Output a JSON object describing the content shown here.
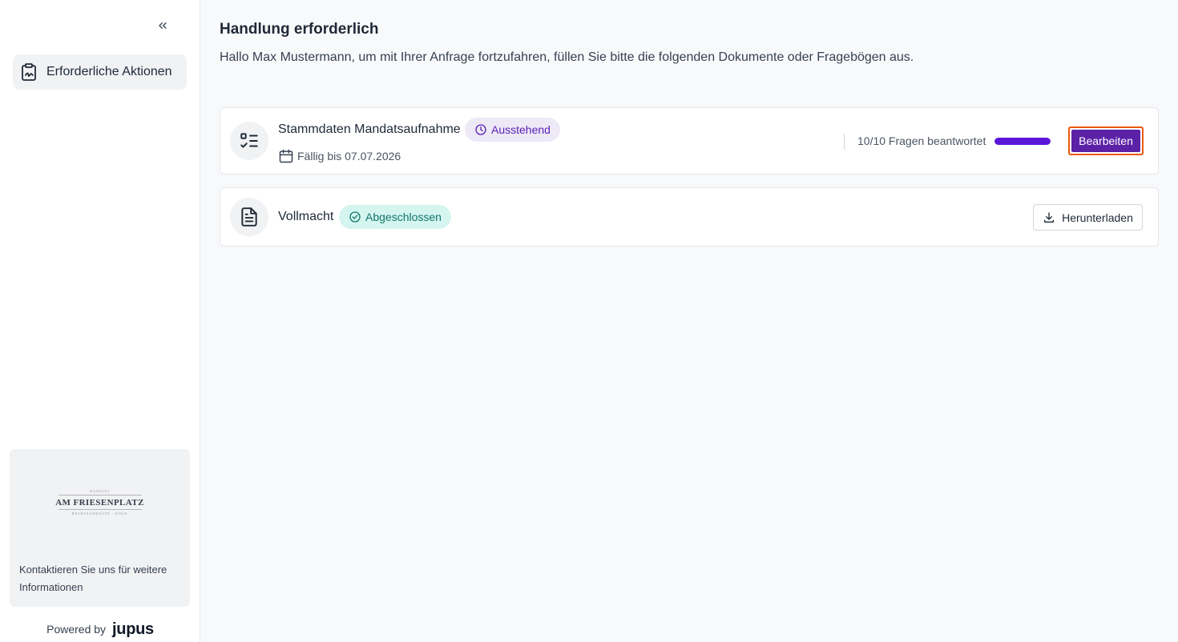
{
  "sidebar": {
    "collapse_icon": "chevrons-left-icon",
    "nav": [
      {
        "label": "Erforderliche Aktionen",
        "icon": "clipboard-signature-icon",
        "active": true
      }
    ],
    "contact": {
      "logo": {
        "top": "KANZLEI",
        "name": "AM FRIESENPLATZ",
        "bottom": "RECHTSANWÄLTE · KÖLN"
      },
      "text": "Kontaktieren Sie uns für weitere Informationen"
    },
    "powered_by": {
      "label": "Powered by",
      "brand": "jupus"
    }
  },
  "main": {
    "title": "Handlung erforderlich",
    "subtitle": "Hallo Max Mustermann, um mit Ihrer Anfrage fortzufahren, füllen Sie bitte die folgenden Dokumente oder Fragebögen aus.",
    "items": [
      {
        "title": "Stammdaten Mandatsaufnahme",
        "icon": "list-checks-icon",
        "status": "Ausstehend",
        "status_icon": "clock-icon",
        "due": "Fällig bis 07.07.2026",
        "progress_text": "10/10 Fragen beantwortet",
        "progress": 1.0,
        "action": "Bearbeiten"
      },
      {
        "title": "Vollmacht",
        "icon": "file-text-icon",
        "status": "Abgeschlossen",
        "status_icon": "check-circle-icon",
        "action": "Herunterladen",
        "action_icon": "download-icon"
      }
    ]
  },
  "colors": {
    "accent": "#5b21a6",
    "progress": "#5b16d9",
    "focus_ring": "#ea580c",
    "pending_bg": "#ede9f6",
    "done_bg": "#d5f5ef"
  }
}
